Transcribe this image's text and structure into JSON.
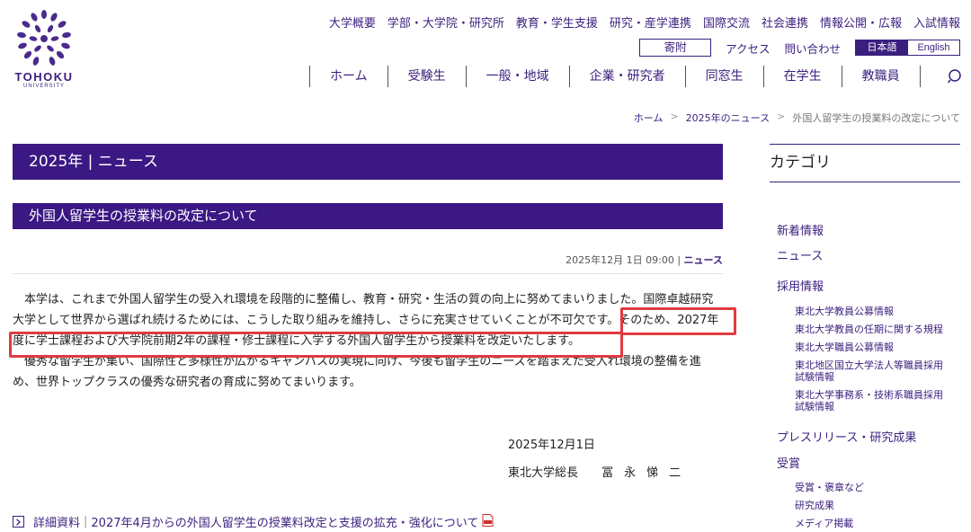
{
  "brand": {
    "name": "TOHOKU",
    "sub": "UNIVERSITY"
  },
  "top_nav": [
    "大学概要",
    "学部・大学院・研究所",
    "教育・学生支援",
    "研究・産学連携",
    "国際交流",
    "社会連携",
    "情報公開・広報",
    "入試情報"
  ],
  "util": {
    "donate": "寄附",
    "access": "アクセス",
    "contact": "問い合わせ",
    "lang_ja": "日本語",
    "lang_en": "English"
  },
  "main_nav": [
    "ホーム",
    "受験生",
    "一般・地域",
    "企業・研究者",
    "同窓生",
    "在学生",
    "教職員"
  ],
  "breadcrumb": {
    "home": "ホーム",
    "news": "2025年のニュース",
    "current": "外国人留学生の授業料の改定について",
    "sep": ">"
  },
  "section_title": "2025年 | ニュース",
  "article": {
    "title": "外国人留学生の授業料の改定について",
    "date": "2025年12月 1日 09:00 |",
    "category": "ニュース",
    "p1": "本学は、これまで外国人留学生の受入れ環境を段階的に整備し、教育・研究・生活の質の向上に努めてまいりました。国際卓越研究大学として世界から選ばれ続けるためには、こうした取り組みを維持し、さらに充実させていくことが不可欠です。そのため、2027年度に学士課程および大学院前期2年の課程・修士課程に入学する外国人留学生から授業料を改定いたします。",
    "p2": "優秀な留学生が集い、国際性と多様性が広がるキャンパスの実現に向け、今後も留学生のニーズを踏まえた受入れ環境の整備を進め、世界トップクラスの優秀な研究者の育成に努めてまいります。",
    "sign_date": "2025年12月1日",
    "sign_title": "東北大学総長",
    "sign_name": "冨永悌二",
    "attachment_label": "詳細資料",
    "attachment_title": "2027年4月からの外国人留学生の授業料改定と支援の拡充・強化について"
  },
  "sidebar": {
    "title": "カテゴリ",
    "items": [
      {
        "label": "新着情報"
      },
      {
        "label": "ニュース"
      },
      {
        "label": "採用情報",
        "children": [
          "東北大学教員公募情報",
          "東北大学教員の任期に関する規程",
          "東北大学職員公募情報"
        ]
      },
      {
        "label": "",
        "children": []
      },
      {
        "label": "プレスリリース・研究成果"
      },
      {
        "label": "受賞",
        "children": [
          "受賞・褒章など",
          "研究成果",
          "メディア掲載"
        ]
      }
    ],
    "multiline": [
      [
        "東北地区国立大学法人等職員採用",
        "試験情報"
      ],
      [
        "東北大学事務系・技術系職員採用",
        "試験情報"
      ]
    ]
  },
  "colors": {
    "brand_purple": "#3b1883",
    "highlight_red": "#e03a3f"
  }
}
